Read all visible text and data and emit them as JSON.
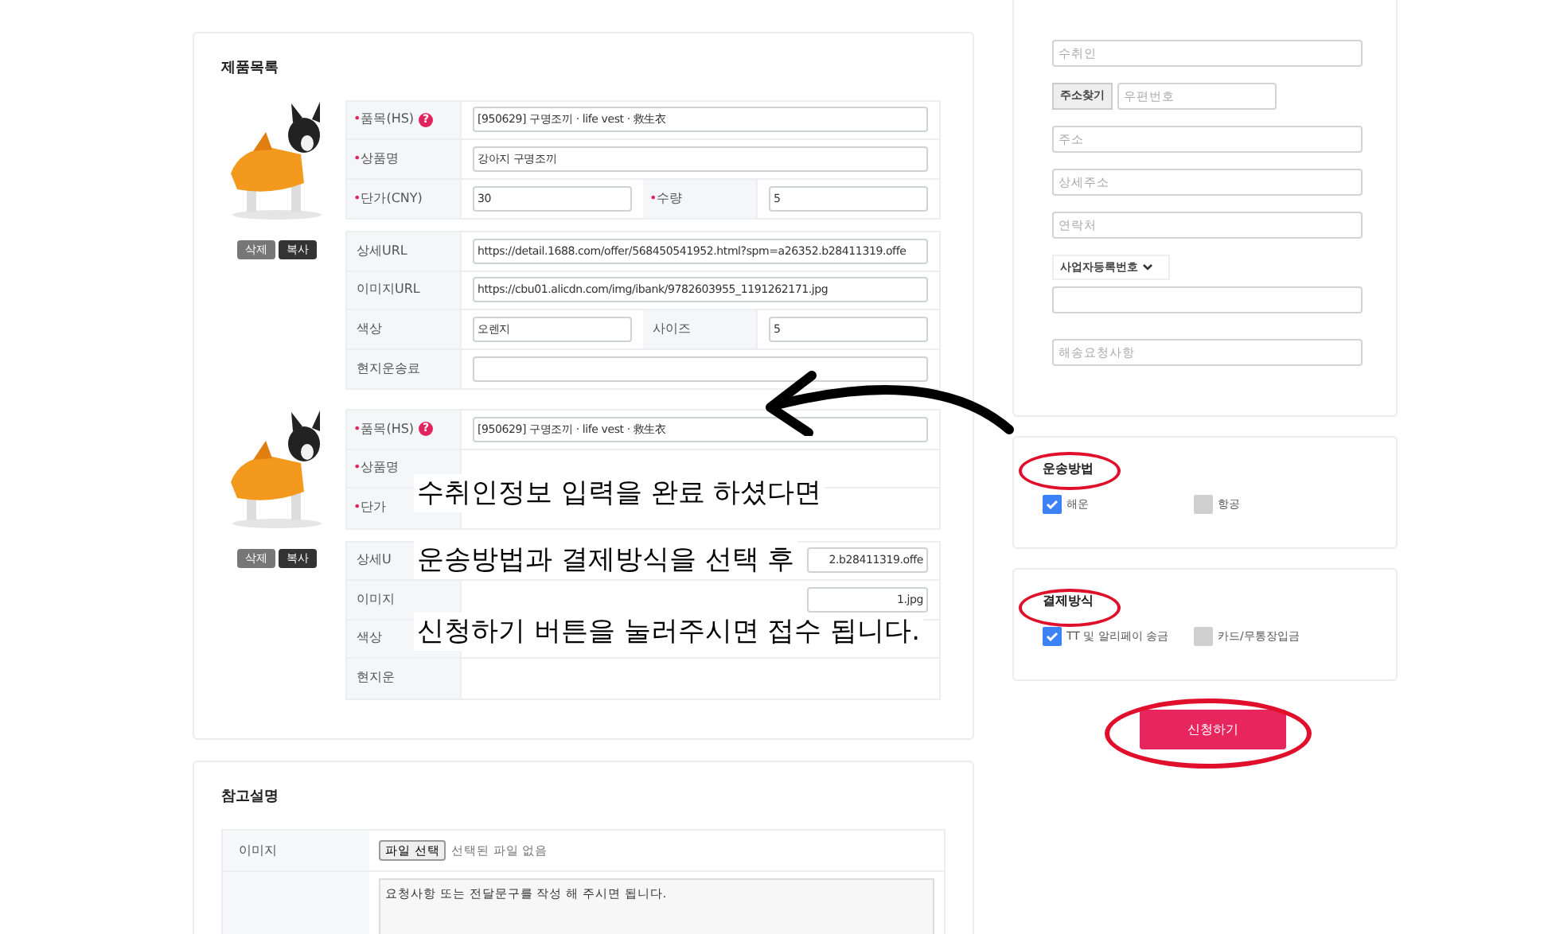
{
  "products": [
    {
      "buttons": [
        "삭제",
        "복사"
      ],
      "groups": [
        [
          [
            {
              "label": "품목(HS)",
              "required": true,
              "help": "?",
              "value": "[950629] 구명조끼 · life vest · 救生衣",
              "input": true
            }
          ],
          [
            {
              "label": "상품명",
              "required": true,
              "value": "강아지 구명조끼",
              "input": true
            }
          ],
          [
            {
              "label": "단가(CNY)",
              "required": true,
              "value": "30",
              "input": true
            },
            {
              "label": "수량",
              "required": true,
              "value": "5",
              "input": true
            }
          ]
        ],
        [
          [
            {
              "label": "상세URL",
              "required": false,
              "value": "https://detail.1688.com/offer/568450541952.html?spm=a26352.b28411319.offe",
              "input": true
            }
          ],
          [
            {
              "label": "이미지URL",
              "required": false,
              "value": "https://cbu01.alicdn.com/img/ibank/9782603955_1191262171.jpg",
              "input": true
            }
          ],
          [
            {
              "label": "색상",
              "required": false,
              "value": "오렌지",
              "input": true
            },
            {
              "label": "사이즈",
              "required": false,
              "value": "5",
              "input": true
            }
          ],
          [
            {
              "label": "현지운송료",
              "required": false,
              "input": true
            }
          ]
        ]
      ]
    },
    {
      "buttons": [
        "삭제",
        "복사"
      ],
      "groups": [
        [
          [
            {
              "label": "품목(HS)",
              "required": true,
              "help": "?",
              "value": "[950629] 구명조끼 · life vest · 救生衣",
              "input": true
            }
          ],
          [
            {
              "label": "상품명",
              "required": true,
              "input": false
            }
          ],
          [
            {
              "label": "단가",
              "required": true,
              "input": false
            }
          ]
        ],
        [
          [
            {
              "label": "상세U",
              "required": false,
              "value": "2.b28411319.offe",
              "input": true
            }
          ],
          [
            {
              "label": "이미지",
              "required": false,
              "value": "1.jpg",
              "input": true
            }
          ],
          [
            {
              "label": "색상",
              "required": false,
              "input": false
            }
          ],
          [
            {
              "label": "현지운",
              "required": false,
              "input": false
            }
          ]
        ]
      ]
    }
  ],
  "required_marker": "•",
  "product_list_title": "제품목록",
  "note": [
    "수취인정보 입력을 완료 하셨다면",
    "운송방법과 결제방식을 선택 후",
    "신청하기 버튼을 눌러주시면 접수 됩니다."
  ],
  "recipient": {
    "name_placeholder": "수취인",
    "address_search": "주소찾기",
    "zip_placeholder": "우편번호",
    "address_placeholder": "주소",
    "detail_placeholder": "상세주소",
    "phone_placeholder": "연락처",
    "id_type": "사업자등록번호",
    "request_placeholder": "해송요청사항"
  },
  "shipping": {
    "title": "운송방법",
    "options": [
      {
        "label": "해운",
        "checked": true
      },
      {
        "label": "항공",
        "checked": false
      }
    ]
  },
  "payment": {
    "title": "결제방식",
    "options": [
      {
        "label": "TT 및 알리페이 송금",
        "checked": true
      },
      {
        "label": "카드/무통장입금",
        "checked": false
      }
    ]
  },
  "submit": "신청하기",
  "reference": {
    "title": "참고설명",
    "image_label": "이미지",
    "file_button": "파일 선택",
    "file_status": "선택된 파일 없음",
    "message": "요청사항 또는 전달문구를 작성 해 주시면 됩니다."
  }
}
